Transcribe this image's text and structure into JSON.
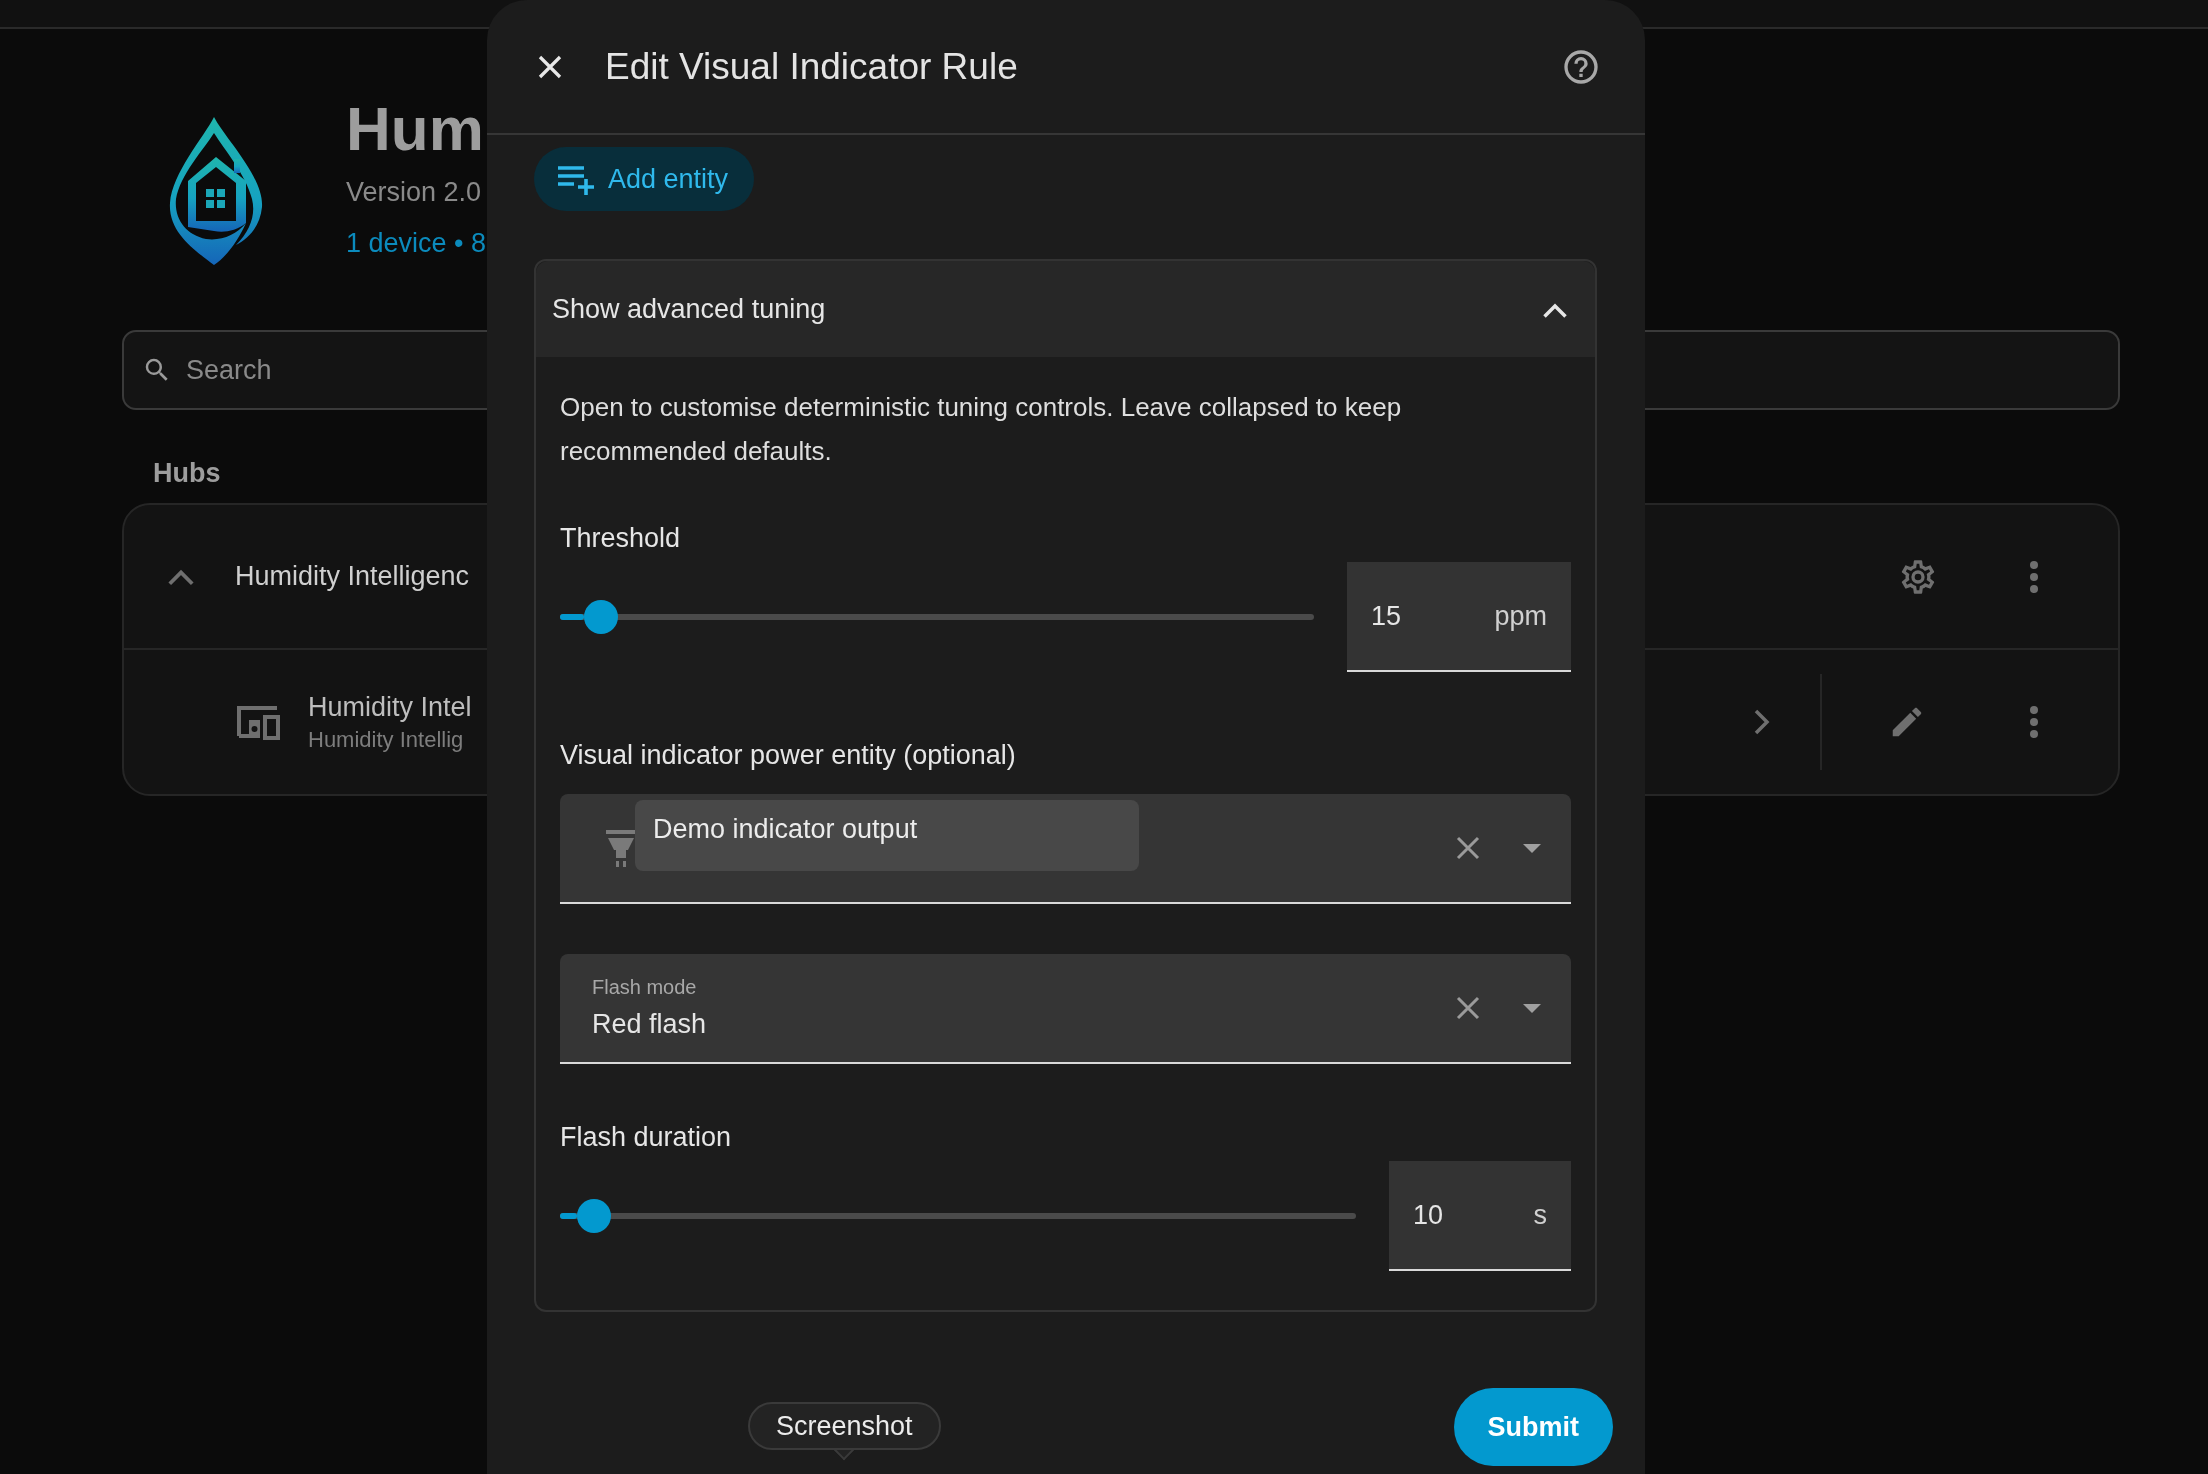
{
  "background": {
    "title": "Hum",
    "version": "Version 2.0",
    "summary": "1 device • 8",
    "search": {
      "placeholder": "Search"
    },
    "section_label": "Hubs",
    "hub": {
      "name": "Humidity Intelligenc",
      "expanded": true,
      "devices": [
        {
          "name": "Humidity Intel",
          "subtitle": "Humidity Intellig"
        }
      ]
    }
  },
  "dialog": {
    "title": "Edit Visual Indicator Rule",
    "add_button": "Add entity",
    "advanced": {
      "title": "Show advanced tuning",
      "expanded": true,
      "description": "Open to customise deterministic tuning controls. Leave collapsed to keep recommended defaults.",
      "threshold": {
        "label": "Threshold",
        "level": 0.054,
        "value": "15",
        "unit": "ppm"
      },
      "entity": {
        "label": "Visual indicator power entity (optional)",
        "tooltip": "Demo indicator output"
      },
      "flash_mode": {
        "label": "Flash mode",
        "value": "Red flash"
      },
      "flash_duration": {
        "label": "Flash duration",
        "level": 0.043,
        "value": "10",
        "unit": "s"
      }
    },
    "tooltip": "Screenshot",
    "submit": "Submit"
  }
}
